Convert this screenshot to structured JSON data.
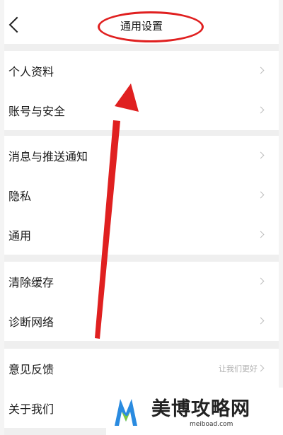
{
  "header": {
    "title": "通用设置"
  },
  "groups": [
    [
      {
        "label": "个人资料"
      },
      {
        "label": "账号与安全"
      }
    ],
    [
      {
        "label": "消息与推送通知"
      },
      {
        "label": "隐私"
      },
      {
        "label": "通用"
      }
    ],
    [
      {
        "label": "清除缓存"
      },
      {
        "label": "诊断网络"
      }
    ],
    [
      {
        "label": "意见反馈",
        "extra": "让我们更好"
      },
      {
        "label": "关于我们"
      }
    ]
  ],
  "watermark": {
    "brand": "美博攻略网",
    "url": "meiboad.com"
  },
  "colors": {
    "annotation_red": "#e02020",
    "chevron": "#bdbdbd",
    "background": "#efefef"
  }
}
